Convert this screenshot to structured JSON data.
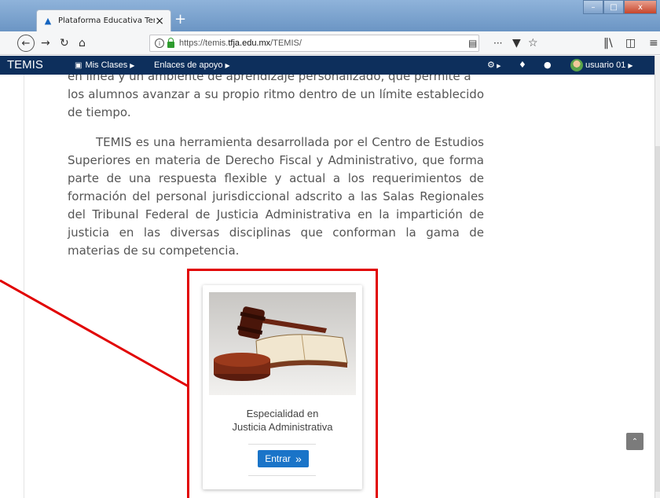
{
  "window": {
    "tab_title": "Plataforma Educativa Temis",
    "tab_close": "×",
    "new_tab": "+",
    "controls": [
      "–",
      "□",
      "x"
    ]
  },
  "navbar": {
    "url_prefix": "https://temis.",
    "url_domain": "tfja.edu.mx",
    "url_path": "/TEMIS/",
    "overflow": "···"
  },
  "site": {
    "brand": "TEMIS",
    "menu_classes": "Mis Clases",
    "menu_links": "Enlaces de apoyo",
    "user_name": "usuario 01"
  },
  "content": {
    "cut_line": "en línea y un ambiente de aprendizaje personalizado, que permite a",
    "intro_text": "los alumnos avanzar a su propio ritmo dentro de un límite establecido de tiempo.",
    "main_text": "TEMIS es una herramienta desarrollada por el Centro de Estudios Superiores en materia de Derecho Fiscal y Administrativo, que forma parte de una respuesta flexible y actual a los requerimientos de formación del personal jurisdiccional adscrito a las Salas Regionales del Tribunal Federal de Justicia Administrativa en la impartición de justicia en las diversas disciplinas que conforman la gama de materias de su competencia."
  },
  "card": {
    "title_line1": "Especialidad en",
    "title_line2": "Justicia Administrativa",
    "button_label": "Entrar",
    "button_icon": "»"
  },
  "colors": {
    "header_bg": "#0d2f5c",
    "button_bg": "#1a74c8",
    "highlight": "#e10000"
  },
  "icons": [
    "back-icon",
    "forward-icon",
    "reload-icon",
    "home-icon",
    "info-icon",
    "lock-icon",
    "reader-icon",
    "pocket-icon",
    "star-icon",
    "library-icon",
    "sidebar-icon",
    "menu-icon",
    "gear-icon",
    "bell-icon",
    "chat-icon",
    "avatar",
    "chevron-up-icon"
  ]
}
